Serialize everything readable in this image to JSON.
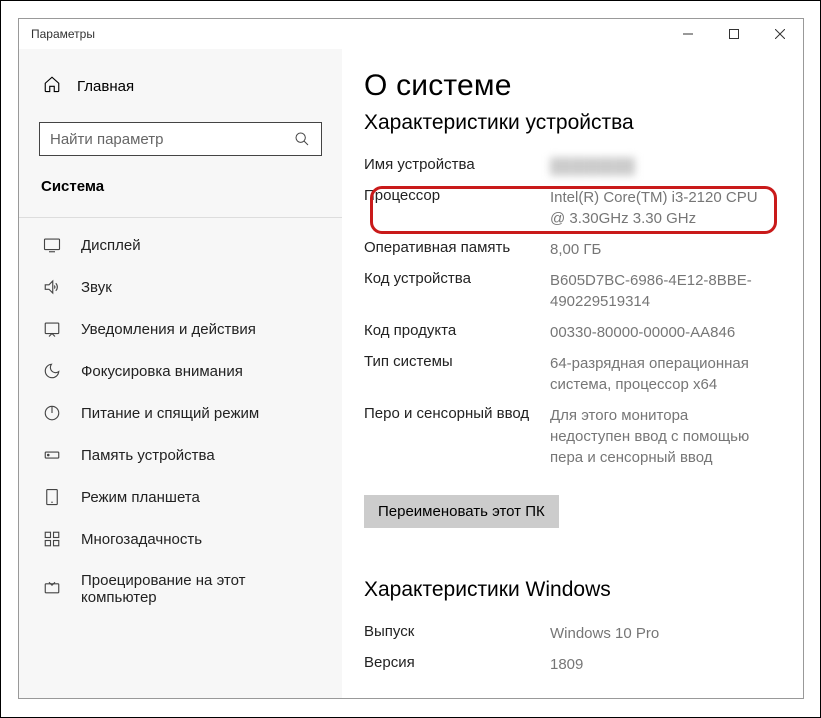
{
  "window": {
    "title": "Параметры"
  },
  "sidebar": {
    "home": "Главная",
    "search_placeholder": "Найти параметр",
    "section": "Система",
    "items": [
      {
        "label": "Дисплей"
      },
      {
        "label": "Звук"
      },
      {
        "label": "Уведомления и действия"
      },
      {
        "label": "Фокусировка внимания"
      },
      {
        "label": "Питание и спящий режим"
      },
      {
        "label": "Память устройства"
      },
      {
        "label": "Режим планшета"
      },
      {
        "label": "Многозадачность"
      },
      {
        "label": "Проецирование на этот компьютер"
      }
    ]
  },
  "content": {
    "title": "О системе",
    "specs_header": "Характеристики устройства",
    "specs": [
      {
        "label": "Имя устройства",
        "value": ""
      },
      {
        "label": "Процессор",
        "value": "Intel(R) Core(TM) i3-2120 CPU @ 3.30GHz   3.30 GHz"
      },
      {
        "label": "Оперативная память",
        "value": "8,00 ГБ"
      },
      {
        "label": "Код устройства",
        "value": "B605D7BC-6986-4E12-8BBE-490229519314"
      },
      {
        "label": "Код продукта",
        "value": "00330-80000-00000-AA846"
      },
      {
        "label": "Тип системы",
        "value": "64-разрядная операционная система, процессор x64"
      },
      {
        "label": "Перо и сенсорный ввод",
        "value": "Для этого монитора недоступен ввод с помощью пера и сенсорный ввод"
      }
    ],
    "rename_button": "Переименовать этот ПК",
    "win_header": "Характеристики Windows",
    "win_specs": [
      {
        "label": "Выпуск",
        "value": "Windows 10 Pro"
      },
      {
        "label": "Версия",
        "value": "1809"
      }
    ]
  }
}
